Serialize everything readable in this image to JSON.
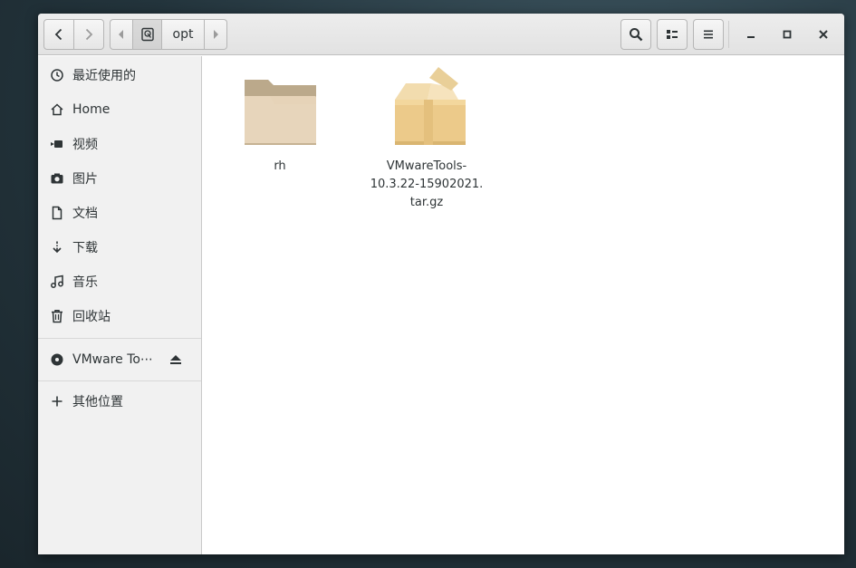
{
  "headerbar": {
    "back_icon": "chevron-left-icon",
    "forward_icon": "chevron-right-icon",
    "path": {
      "prev_icon": "triangle-left-icon",
      "home_icon": "drive-icon",
      "current": "opt",
      "next_icon": "triangle-right-icon"
    },
    "search_icon": "search-icon",
    "view_icon": "list-view-icon",
    "menu_icon": "hamburger-menu-icon",
    "minimize_icon": "minimize-icon",
    "maximize_icon": "maximize-icon",
    "close_icon": "close-icon"
  },
  "sidebar": {
    "places": [
      {
        "label": "最近使用的",
        "icon": "clock-icon"
      },
      {
        "label": "Home",
        "icon": "home-icon"
      },
      {
        "label": "视频",
        "icon": "video-icon"
      },
      {
        "label": "图片",
        "icon": "camera-icon"
      },
      {
        "label": "文档",
        "icon": "document-icon"
      },
      {
        "label": "下载",
        "icon": "download-icon"
      },
      {
        "label": "音乐",
        "icon": "music-icon"
      },
      {
        "label": "回收站",
        "icon": "trash-icon"
      }
    ],
    "device": {
      "label": "VMware To⋯",
      "icon": "disc-icon",
      "eject_icon": "eject-icon"
    },
    "other": {
      "label": "其他位置",
      "icon": "plus-icon"
    }
  },
  "files": [
    {
      "name": "rh",
      "icon": "folder-icon"
    },
    {
      "name_lines": [
        "VMwareTools-",
        "10.3.22-15902021.",
        "tar.gz"
      ],
      "icon": "package-box-icon"
    }
  ],
  "colors": {
    "folder_back": "#bba98b",
    "folder_front": "#e6d3b8",
    "box_main": "#ecca8a",
    "box_dark": "#d9b571"
  }
}
